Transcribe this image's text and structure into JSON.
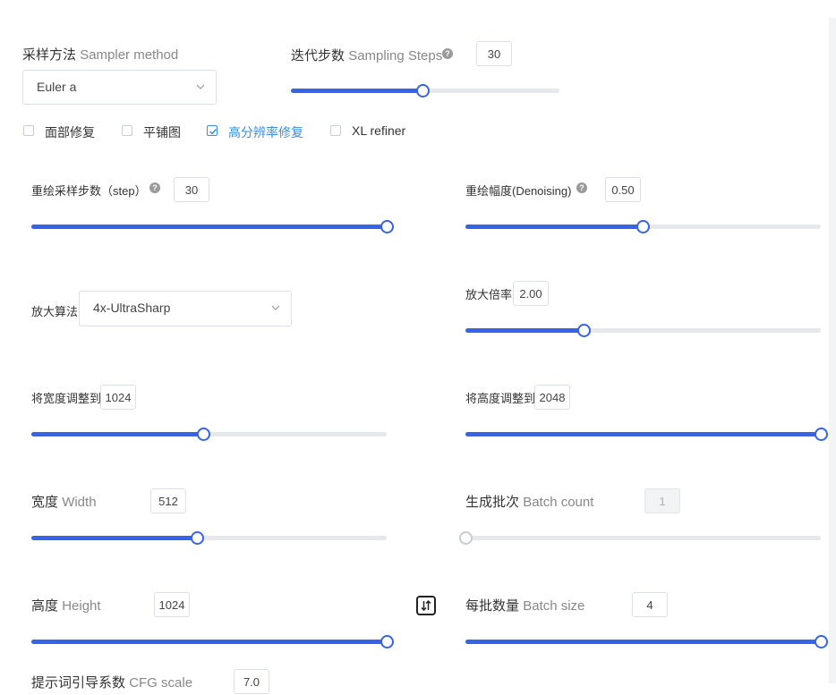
{
  "sampler": {
    "label_cn": "采样方法",
    "label_en": "Sampler method",
    "value": "Euler a"
  },
  "steps": {
    "label_cn": "迭代步数",
    "label_en": "Sampling Steps",
    "value": "30",
    "level": 0.49
  },
  "checkboxes": [
    {
      "label": "面部修复",
      "checked": false
    },
    {
      "label": "平铺图",
      "checked": false
    },
    {
      "label": "高分辨率修复",
      "checked": true
    },
    {
      "label": "XL refiner",
      "checked": false
    }
  ],
  "hires_steps": {
    "label": "重绘采样步数（step）",
    "value": "30",
    "level": 1.0
  },
  "denoising": {
    "label": "重绘幅度(Denoising)",
    "value": "0.50",
    "level": 0.5
  },
  "upscaler": {
    "label": "放大算法",
    "value": "4x-UltraSharp"
  },
  "upscale_by": {
    "label": "放大倍率",
    "value": "2.00",
    "level": 0.33
  },
  "resize_width": {
    "label": "将宽度调整到",
    "value": "1024",
    "level": 0.48
  },
  "resize_height": {
    "label": "将高度调整到",
    "value": "2048",
    "level": 1.0
  },
  "width": {
    "label_cn": "宽度",
    "label_en": "Width",
    "value": "512",
    "level": 0.47
  },
  "batch_count": {
    "label_cn": "生成批次",
    "label_en": "Batch count",
    "value": "1",
    "level": 0.0
  },
  "height": {
    "label_cn": "高度",
    "label_en": "Height",
    "value": "1024",
    "level": 1.0
  },
  "batch_size": {
    "label_cn": "每批数量",
    "label_en": "Batch size",
    "value": "4",
    "level": 1.0
  },
  "cfg": {
    "label_cn": "提示词引导系数",
    "label_en": "CFG scale",
    "value": "7.0"
  },
  "colors": {
    "accent": "#3563e9",
    "check": "#3a8ee6",
    "track": "#e6e8eb"
  },
  "icons": [
    "help-icon",
    "chevron-down-icon",
    "check-icon",
    "swap-dimensions-icon"
  ]
}
